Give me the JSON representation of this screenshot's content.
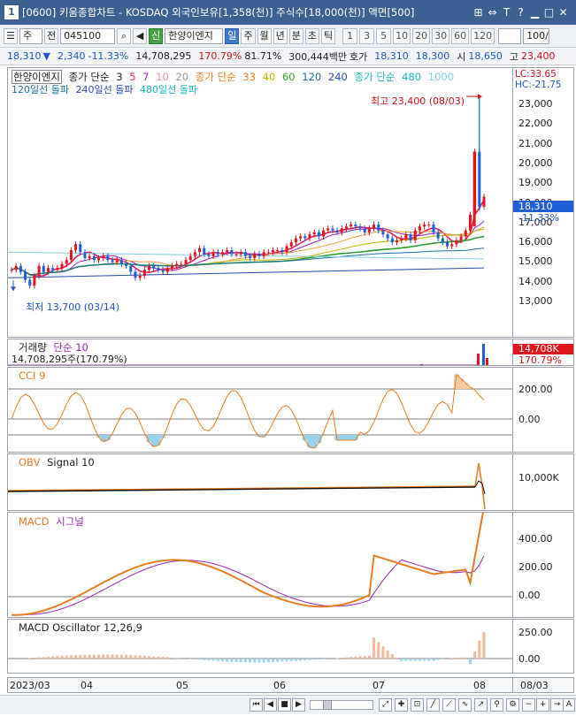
{
  "window": {
    "tab_id": "1",
    "title": "[0600] 키움종합차트 - KOSDAQ 외국인보유[1,358(천)] 주식수[18,000(천)] 액면[500]"
  },
  "toolbar": {
    "period_type": "주",
    "prev": "전",
    "code": "045100",
    "stock_name": "한양이엔지",
    "new_badge": "신",
    "periods": [
      "일",
      "주",
      "월",
      "년",
      "분",
      "초",
      "틱"
    ],
    "intervals": [
      "1",
      "3",
      "5",
      "10",
      "20",
      "30",
      "60",
      "120"
    ],
    "count": "100/"
  },
  "info": {
    "price": "18,310",
    "change": "2,340",
    "change_pct": "-11.33%",
    "volume": "14,708,295",
    "vol_ratio": "170.79%",
    "turnover": "81.71%",
    "amount": "300,444백만",
    "quote_label": "호가",
    "bid": "18,310",
    "ask": "18,300",
    "open_label": "시",
    "open": "18,650",
    "high_label": "고",
    "high": "23,400"
  },
  "price_pane": {
    "name": "한양이엔지",
    "ma_title": "종가 단순",
    "ma_short": [
      "3",
      "5",
      "7",
      "10",
      "20"
    ],
    "ma_mid_title": "종가 단순",
    "ma_mid": [
      "33",
      "40",
      "60",
      "120",
      "240"
    ],
    "ma_long_title": "종가 단순",
    "ma_long": [
      "480",
      "1000"
    ],
    "breakout_120": "120일선 돌파",
    "breakout_240": "240일선 돌파",
    "breakout_480": "480일선 돌파",
    "high_note": "최고 23,400 (08/03)",
    "low_note": "최저 13,700 (03/14)",
    "lc": "LC:33.65",
    "hc": "HC:-21.75",
    "last_price": "18,310",
    "last_pct": "-11.33%",
    "y_ticks": [
      "23,000",
      "22,000",
      "21,000",
      "20,000",
      "19,000",
      "18,000",
      "17,000",
      "16,000",
      "15,000",
      "14,000",
      "13,000"
    ],
    "colors": {
      "up": "#e0161c",
      "down": "#1f5fd6"
    }
  },
  "volume_pane": {
    "title": "거래량",
    "ma": "단순 10",
    "value": "14,708,295주(170.79%)",
    "axis_value": "14,708K",
    "axis_pct": "170.79%"
  },
  "cci_pane": {
    "title": "CCI 9",
    "y_ticks": [
      "200.00",
      "0.00"
    ]
  },
  "obv_pane": {
    "title": "OBV",
    "signal": "Signal 10",
    "y_ticks": [
      "10,000K"
    ]
  },
  "macd_pane": {
    "title": "MACD",
    "signal": "시그널",
    "y_ticks": [
      "400.00",
      "200.00",
      "0.00"
    ]
  },
  "osc_pane": {
    "title": "MACD Oscillator 12,26,9",
    "y_ticks": [
      "250.00",
      "0.00"
    ]
  },
  "x_axis": {
    "labels": [
      "2023/03",
      "04",
      "05",
      "06",
      "07",
      "08"
    ],
    "right_label": "08/03"
  },
  "chart_data": {
    "type": "line",
    "title": "한양이엔지",
    "ylim": [
      12600,
      23600
    ],
    "high": {
      "value": 23400,
      "date": "08/03"
    },
    "low": {
      "value": 13700,
      "date": "03/14"
    },
    "close_series": [
      14600,
      14800,
      14500,
      14100,
      13800,
      14300,
      14800,
      14500,
      14700,
      14600,
      14700,
      14900,
      15100,
      15600,
      15900,
      15500,
      15200,
      15300,
      15100,
      15200,
      15300,
      15100,
      15000,
      15100,
      14900,
      14800,
      14500,
      14200,
      14300,
      14600,
      14800,
      14700,
      14600,
      14500,
      14700,
      14800,
      14900,
      14900,
      15100,
      15300,
      15500,
      15700,
      15400,
      15300,
      15500,
      15400,
      15500,
      15600,
      15400,
      15400,
      15500,
      15300,
      15200,
      15400,
      15300,
      15500,
      15500,
      15600,
      15600,
      15500,
      15800,
      16000,
      16200,
      16300,
      16200,
      16400,
      16500,
      16300,
      16600,
      16700,
      16600,
      16500,
      16700,
      16800,
      16900,
      16800,
      16700,
      16500,
      16700,
      16900,
      16600,
      16400,
      16200,
      16000,
      16100,
      16200,
      16400,
      16100,
      16600,
      16800,
      16900,
      16900,
      16500,
      16200,
      16000,
      15800,
      15900,
      16100,
      16300,
      16600,
      17400,
      20600,
      17800,
      18310
    ],
    "last": 18310
  }
}
